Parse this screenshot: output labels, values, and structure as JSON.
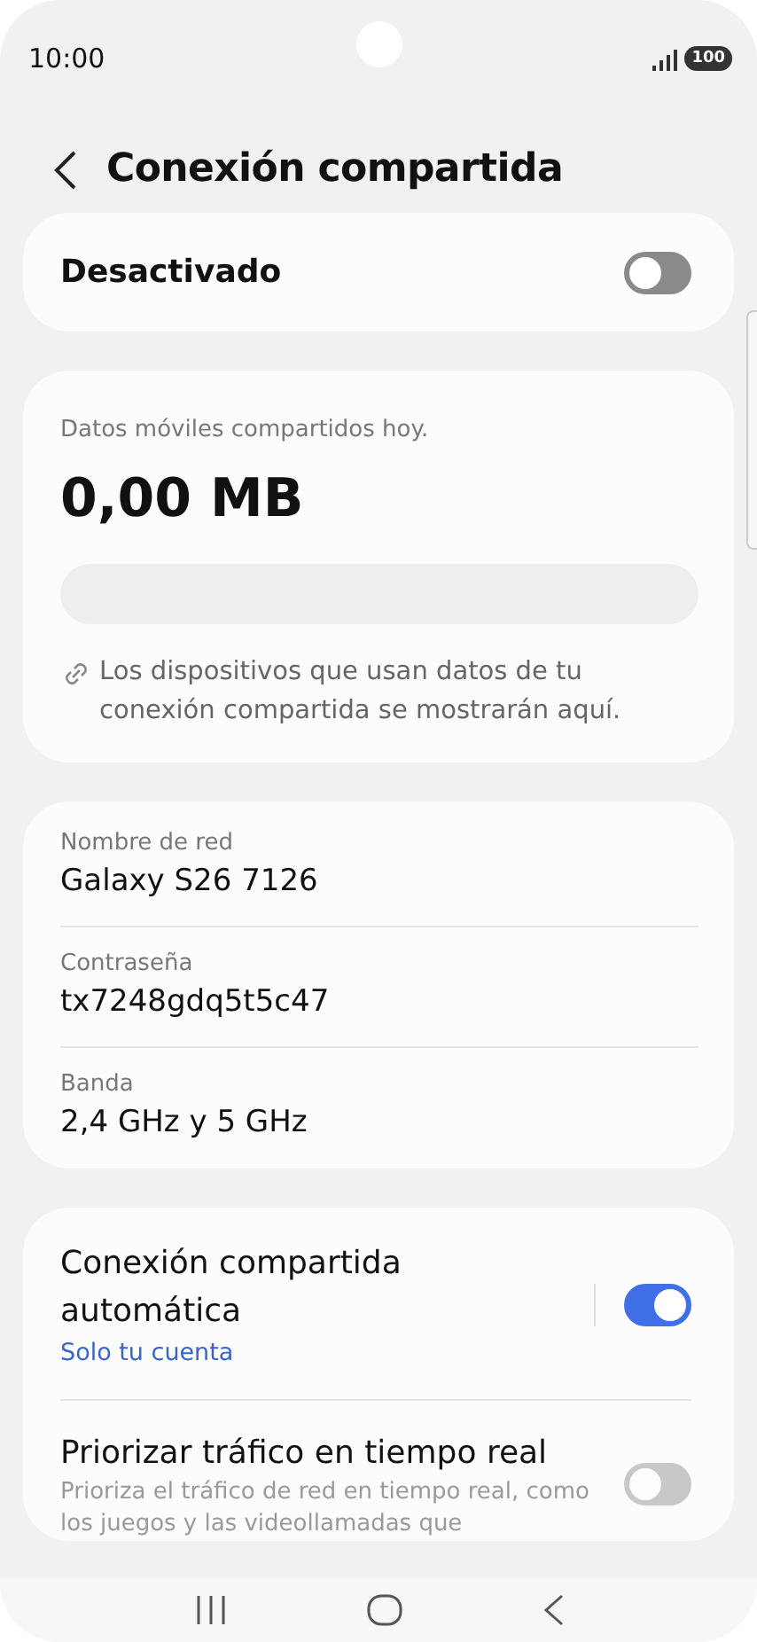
{
  "status_bar": {
    "time": "10:00",
    "battery": "100"
  },
  "header": {
    "title": "Conexión compartida"
  },
  "master_switch": {
    "label": "Desactivado",
    "on": false
  },
  "usage": {
    "caption": "Datos móviles compartidos hoy.",
    "amount": "0,00 MB",
    "note": "Los dispositivos que usan datos de tu conexión compartida se mostrarán aquí."
  },
  "network_fields": [
    {
      "label": "Nombre de red",
      "value": "Galaxy S26 7126"
    },
    {
      "label": "Contraseña",
      "value": "tx7248gdq5t5c47"
    },
    {
      "label": "Banda",
      "value": "2,4 GHz y 5 GHz"
    }
  ],
  "settings": [
    {
      "title": "Conexión compartida automática",
      "subtitle": "Solo tu cuenta",
      "on": true
    },
    {
      "title": "Priorizar tráfico en tiempo real",
      "description": "Prioriza el tráfico de red en tiempo real, como los juegos y las videollamadas que",
      "on": false
    }
  ]
}
